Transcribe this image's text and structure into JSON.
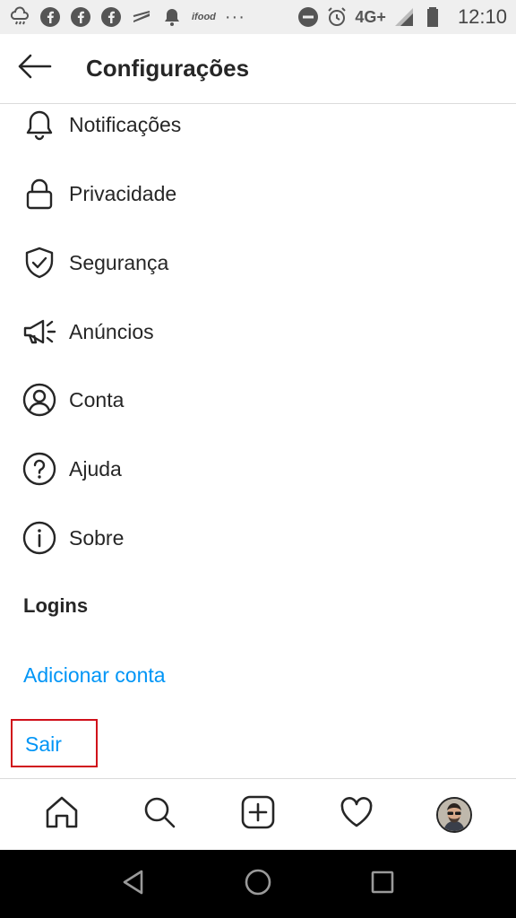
{
  "status_bar": {
    "ifood_label": "ifood",
    "dots": "···",
    "network": "4G+",
    "time": "12:10"
  },
  "header": {
    "title": "Configurações"
  },
  "menu": {
    "items": [
      {
        "label": "Notificações",
        "icon": "bell-icon"
      },
      {
        "label": "Privacidade",
        "icon": "lock-icon"
      },
      {
        "label": "Segurança",
        "icon": "shield-check-icon"
      },
      {
        "label": "Anúncios",
        "icon": "megaphone-icon"
      },
      {
        "label": "Conta",
        "icon": "account-circle-icon"
      },
      {
        "label": "Ajuda",
        "icon": "help-circle-icon"
      },
      {
        "label": "Sobre",
        "icon": "info-circle-icon"
      }
    ]
  },
  "logins": {
    "heading": "Logins",
    "add_account": "Adicionar conta",
    "logout": "Sair"
  },
  "colors": {
    "link": "#0095f6",
    "highlight_box": "#d0101a"
  }
}
